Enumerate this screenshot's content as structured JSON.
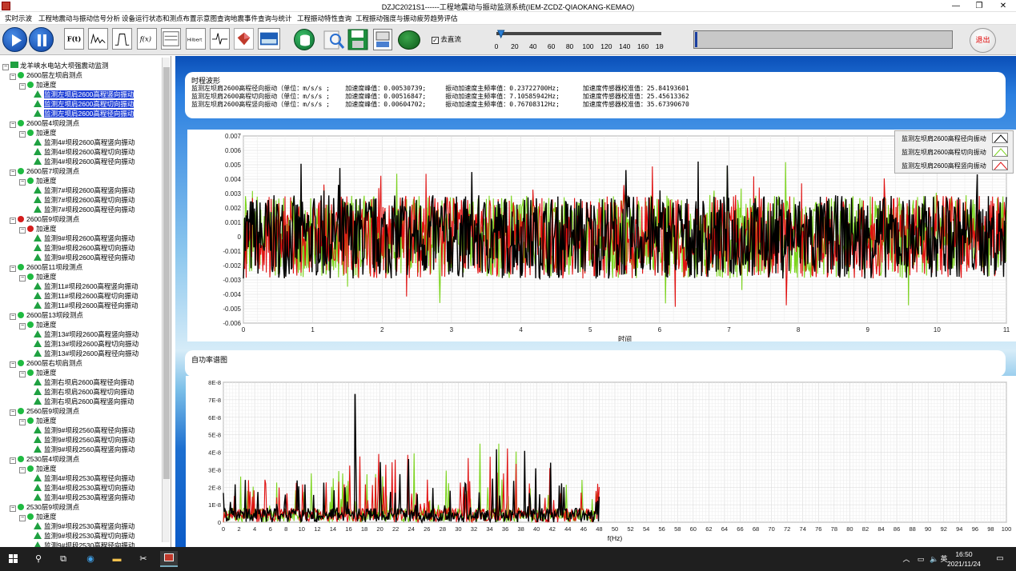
{
  "window": {
    "title": "DZJC2021S1------工程地震动与振动监测系统(IEM-ZCDZ-QIAOKANG-KEMAO)",
    "min": "—",
    "max": "❐",
    "close": "✕"
  },
  "menu": [
    "实时示波",
    "工程地震动与振动信号分析",
    "设备运行状态和测点布置示意图查询",
    "地震事件查询与统计",
    "工程振动特性查询",
    "工程振动强度与振动疲劳趋势评估"
  ],
  "toolbar": {
    "tools": [
      "F(t)",
      "fft-icon",
      "filter-icon",
      "f(x)",
      "harmonic-icon",
      "Hilbert",
      "waveform-icon",
      "3d-icon",
      "image-icon"
    ],
    "dc_checkbox": {
      "label": "去直流",
      "checked": true
    },
    "slider": {
      "value": 5,
      "min": 0,
      "max": 180,
      "ticks": [
        "0",
        "20",
        "40",
        "60",
        "80",
        "100",
        "120",
        "140",
        "160",
        "180"
      ]
    },
    "exit_label": "退出"
  },
  "tree": {
    "root": "龙羊峡水电站大坝强震动监测",
    "groups": [
      {
        "name": "2600层左坝肩测点",
        "status": "green",
        "accel": "加速度",
        "items": [
          "监测左坝肩2600高程竖向振动",
          "监测左坝肩2600高程切向振动",
          "监测左坝肩2600高程径向振动"
        ],
        "selected": true
      },
      {
        "name": "2600层4坝段测点",
        "status": "green",
        "accel": "加速度",
        "items": [
          "监测4#坝段2600高程竖向振动",
          "监测4#坝段2600高程切向振动",
          "监测4#坝段2600高程径向振动"
        ]
      },
      {
        "name": "2600层7坝段测点",
        "status": "green",
        "accel": "加速度",
        "items": [
          "监测7#坝段2600高程竖向振动",
          "监测7#坝段2600高程切向振动",
          "监测7#坝段2600高程径向振动"
        ]
      },
      {
        "name": "2600层9坝段测点",
        "status": "red",
        "accel": "加速度",
        "items": [
          "监测9#坝段2600高程竖向振动",
          "监测9#坝段2600高程切向振动",
          "监测9#坝段2600高程径向振动"
        ]
      },
      {
        "name": "2600层11坝段测点",
        "status": "green",
        "accel": "加速度",
        "items": [
          "监测11#坝段2600高程竖向振动",
          "监测11#坝段2600高程切向振动",
          "监测11#坝段2600高程径向振动"
        ]
      },
      {
        "name": "2600层13坝段测点",
        "status": "green",
        "accel": "加速度",
        "items": [
          "监测13#坝段2600高程竖向振动",
          "监测13#坝段2600高程切向振动",
          "监测13#坝段2600高程径向振动"
        ]
      },
      {
        "name": "2600层右坝肩测点",
        "status": "green",
        "accel": "加速度",
        "items": [
          "监测右坝肩2600高程径向振动",
          "监测右坝肩2600高程切向振动",
          "监测右坝肩2600高程竖向振动"
        ]
      },
      {
        "name": "2560层9坝段测点",
        "status": "green",
        "accel": "加速度",
        "items": [
          "监测9#坝段2560高程径向振动",
          "监测9#坝段2560高程切向振动",
          "监测9#坝段2560高程竖向振动"
        ]
      },
      {
        "name": "2530层4坝段测点",
        "status": "green",
        "accel": "加速度",
        "items": [
          "监测4#坝段2530高程径向振动",
          "监测4#坝段2530高程切向振动",
          "监测4#坝段2530高程竖向振动"
        ]
      },
      {
        "name": "2530层9坝段测点",
        "status": "green",
        "accel": "加速度",
        "items": [
          "监测9#坝段2530高程竖向振动",
          "监测9#坝段2530高程切向振动",
          "监测9#坝段2530高程径向振动"
        ]
      }
    ]
  },
  "info": {
    "label": "时程波形",
    "rows": [
      "监测左坝肩2600高程径向振动（单位：m/s/s ;    加速度峰值：0.00530739;     振动加速度主频率值：0.23722700Hz;      加速度传感器校准值：25.84193601",
      "监测左坝肩2600高程切向振动（单位：m/s/s ;    加速度峰值：0.00516847;     振动加速度主频率值：7.10585942Hz;      加速度传感器校准值：25.45613362",
      "监测左坝肩2600高程竖向振动（单位：m/s/s ;    加速度峰值：0.00604702;     振动加速度主频率值：0.76708312Hz;      加速度传感器校准值：35.67390670"
    ]
  },
  "psd_label": "自功率谱图",
  "chart_data": [
    {
      "type": "line",
      "xlabel": "时间",
      "xlim": [
        0,
        11
      ],
      "ylim": [
        -0.006,
        0.007
      ],
      "xticks": [
        "0",
        "1",
        "2",
        "3",
        "4",
        "5",
        "6",
        "7",
        "8",
        "9",
        "10",
        "11"
      ],
      "yticks": [
        "0.007",
        "0.006",
        "0.005",
        "0.004",
        "0.003",
        "0.002",
        "0.001",
        "0",
        "-0.001",
        "-0.002",
        "-0.003",
        "-0.004",
        "-0.005",
        "-0.006"
      ],
      "grid": true,
      "legend_position": "top-right",
      "series": [
        {
          "name": "监测左坝肩2600高程径向振动",
          "color": "#000000"
        },
        {
          "name": "监测左坝肩2600高程切向振动",
          "color": "#7cd41e"
        },
        {
          "name": "监测左坝肩2600高程竖向振动",
          "color": "#e01010"
        }
      ]
    },
    {
      "type": "line",
      "xlabel": "f(Hz)",
      "xlim": [
        0,
        100
      ],
      "ylim": [
        0,
        8e-08
      ],
      "xticks": [
        "0",
        "2",
        "4",
        "6",
        "8",
        "10",
        "12",
        "14",
        "16",
        "18",
        "20",
        "22",
        "24",
        "26",
        "28",
        "30",
        "32",
        "34",
        "36",
        "38",
        "40",
        "42",
        "44",
        "46",
        "48",
        "50",
        "52",
        "54",
        "56",
        "58",
        "60",
        "62",
        "64",
        "66",
        "68",
        "70",
        "72",
        "74",
        "76",
        "78",
        "80",
        "82",
        "84",
        "86",
        "88",
        "90",
        "92",
        "94",
        "96",
        "98",
        "100"
      ],
      "yticks": [
        "8E-8",
        "7E-8",
        "6E-8",
        "5E-8",
        "4E-8",
        "3E-8",
        "2E-8",
        "1E-8",
        "0"
      ],
      "grid": true,
      "series": [
        {
          "name": "black",
          "color": "#000000",
          "peak": {
            "x": 16.8,
            "y": 7.3e-08
          }
        },
        {
          "name": "green",
          "color": "#7cd41e"
        },
        {
          "name": "red",
          "color": "#e01010"
        }
      ]
    }
  ],
  "taskbar": {
    "time": "16:50",
    "date": "2021/11/24",
    "ime": "英"
  }
}
